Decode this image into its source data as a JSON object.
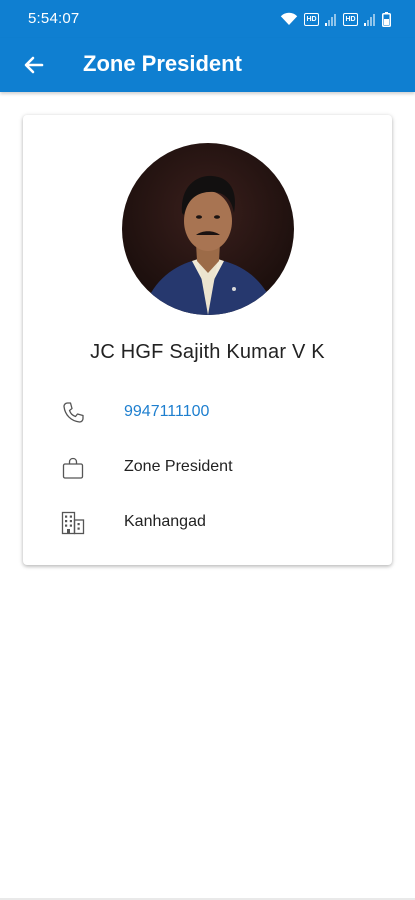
{
  "status_bar": {
    "time": "5:54:07",
    "icons": [
      "wifi-icon",
      "hd-icon",
      "signal-icon",
      "hd-icon",
      "signal-icon",
      "battery-icon"
    ],
    "hd_label": "HD"
  },
  "app_bar": {
    "title": "Zone President",
    "back_icon": "arrow-left-icon",
    "background_color": "#0f7fd1"
  },
  "profile": {
    "name": "JC HGF Sajith Kumar V K",
    "phone": "9947111100",
    "designation": "Zone President",
    "location": "Kanhangad",
    "phone_icon": "phone-icon",
    "designation_icon": "bag-icon",
    "location_icon": "building-icon",
    "link_color": "#1e7fcf"
  }
}
